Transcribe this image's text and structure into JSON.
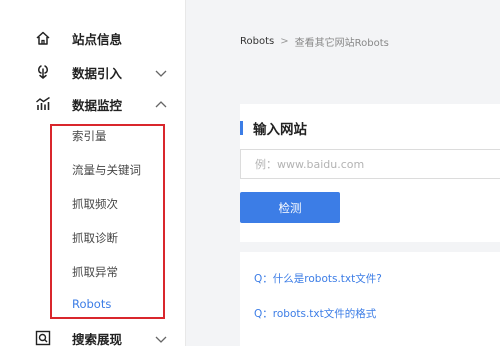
{
  "sidebar": {
    "items": [
      {
        "label": "站点信息",
        "icon": "home-icon"
      },
      {
        "label": "数据引入",
        "icon": "data-import-icon",
        "chevron": "chevron-down-icon"
      },
      {
        "label": "数据监控",
        "icon": "chart-monitor-icon",
        "chevron": "chevron-up-icon"
      },
      {
        "label": "搜索展现",
        "icon": "search-display-icon",
        "chevron": "chevron-down-icon"
      }
    ],
    "sub_items": [
      "索引量",
      "流量与关键词",
      "抓取频次",
      "抓取诊断",
      "抓取异常",
      "Robots"
    ],
    "active_sub": "Robots"
  },
  "breadcrumb": {
    "root": "Robots",
    "separator": ">",
    "current": "查看其它网站Robots"
  },
  "form": {
    "title": "输入网站",
    "input_placeholder": "例：www.baidu.com",
    "button": "检测"
  },
  "faq": {
    "items": [
      "Q：什么是robots.txt文件?",
      "Q：robots.txt文件的格式"
    ]
  },
  "colors": {
    "accent": "#3c7de6",
    "highlight_border": "#d9262c"
  }
}
